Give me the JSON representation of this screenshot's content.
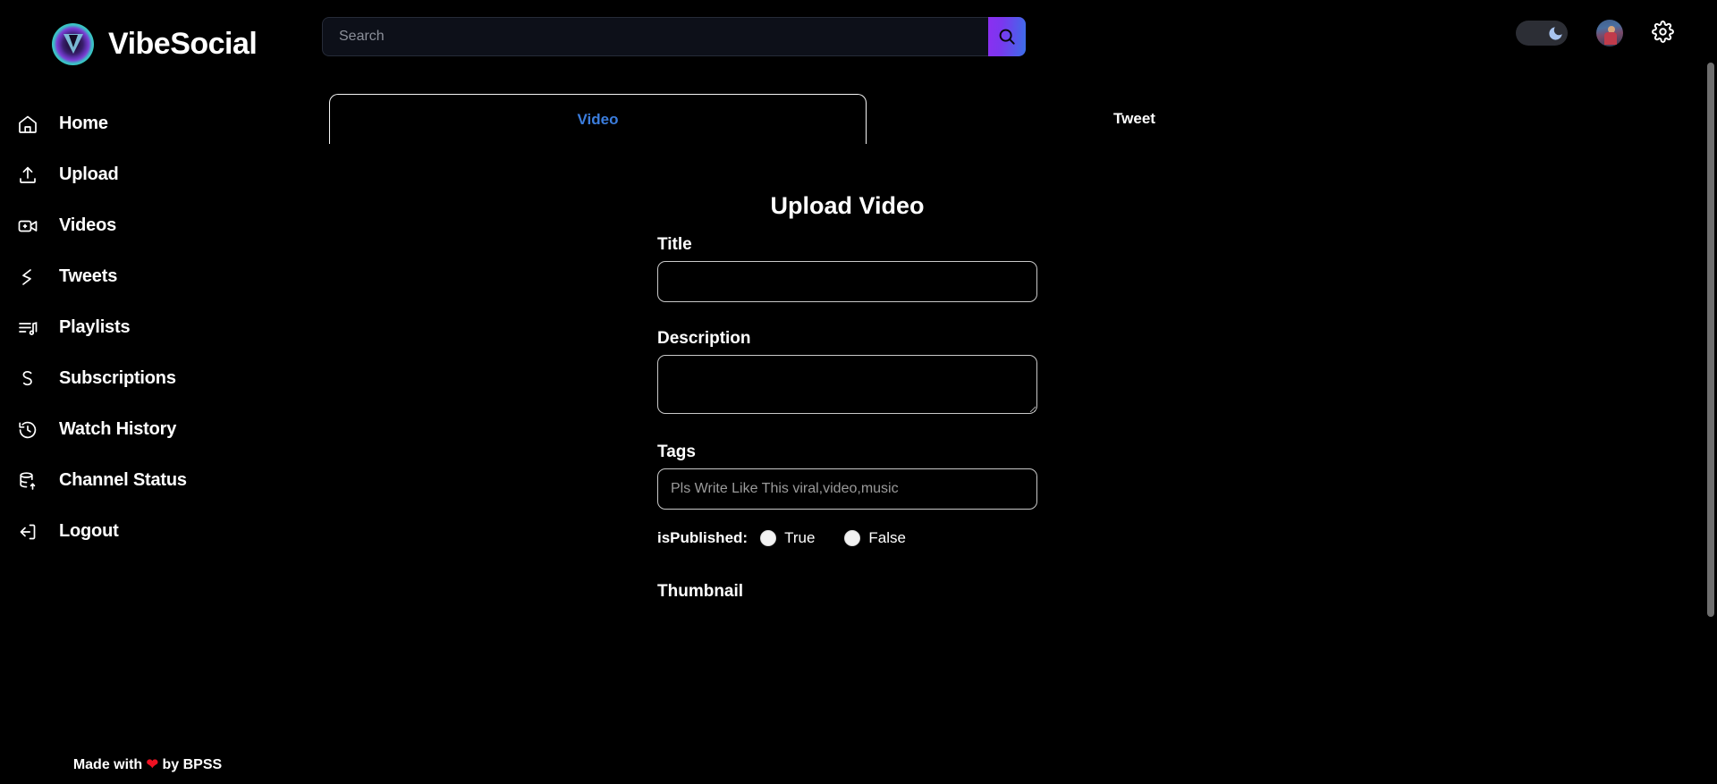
{
  "brand": {
    "name": "VibeSocial",
    "logo_icon": "vibesocial-logo-icon"
  },
  "search": {
    "placeholder": "Search",
    "value": "",
    "button_icon": "search-icon"
  },
  "header": {
    "theme_toggle_icon": "moon-icon",
    "theme_toggle_state": "dark",
    "avatar_icon": "user-avatar",
    "settings_icon": "gear-icon"
  },
  "sidebar": {
    "items": [
      {
        "label": "Home",
        "icon": "home-icon"
      },
      {
        "label": "Upload",
        "icon": "upload-icon"
      },
      {
        "label": "Videos",
        "icon": "video-camera-icon"
      },
      {
        "label": "Tweets",
        "icon": "tweet-icon"
      },
      {
        "label": "Playlists",
        "icon": "playlist-music-icon"
      },
      {
        "label": "Subscriptions",
        "icon": "subscriptions-icon"
      },
      {
        "label": "Watch History",
        "icon": "clock-history-icon"
      },
      {
        "label": "Channel Status",
        "icon": "database-stats-icon"
      },
      {
        "label": "Logout",
        "icon": "logout-icon"
      }
    ],
    "footer_prefix": "Made with",
    "footer_heart": "❤",
    "footer_suffix": "by BPSS"
  },
  "tabs": [
    {
      "label": "Video",
      "active": true
    },
    {
      "label": "Tweet",
      "active": false
    }
  ],
  "form": {
    "title": "Upload Video",
    "title_label": "Title",
    "title_value": "",
    "title_placeholder": "",
    "description_label": "Description",
    "description_value": "",
    "description_placeholder": "",
    "tags_label": "Tags",
    "tags_value": "",
    "tags_placeholder": "Pls Write Like This viral,video,music",
    "is_published_label": "isPublished:",
    "is_published_true": "True",
    "is_published_false": "False",
    "thumbnail_label": "Thumbnail"
  },
  "colors": {
    "background": "#000000",
    "accent_blue": "#3b7ddd",
    "gradient_start": "#8b2ff0",
    "gradient_end": "#3b6fe8",
    "border": "#c9c9c9",
    "heart_red": "#ee1122",
    "search_field": "#0d1019"
  }
}
